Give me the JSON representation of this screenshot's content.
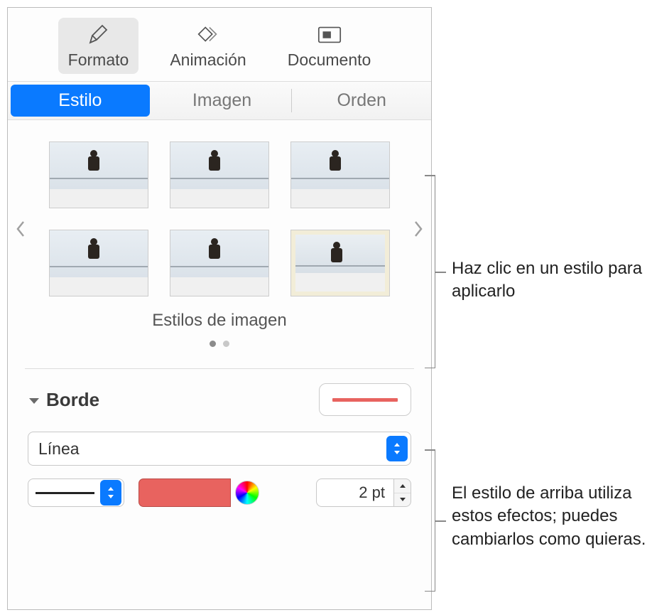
{
  "top_tabs": {
    "formato": "Formato",
    "animacion": "Animación",
    "documento": "Documento"
  },
  "sub_tabs": {
    "estilo": "Estilo",
    "imagen": "Imagen",
    "orden": "Orden"
  },
  "styles": {
    "caption": "Estilos de imagen"
  },
  "border": {
    "title": "Borde",
    "type_label": "Línea",
    "size_value": "2 pt",
    "color": "#e8635f"
  },
  "callouts": {
    "top": "Haz clic en un estilo para aplicarlo",
    "bottom": "El estilo de arriba utiliza estos efectos; puedes cambiarlos como quieras."
  }
}
